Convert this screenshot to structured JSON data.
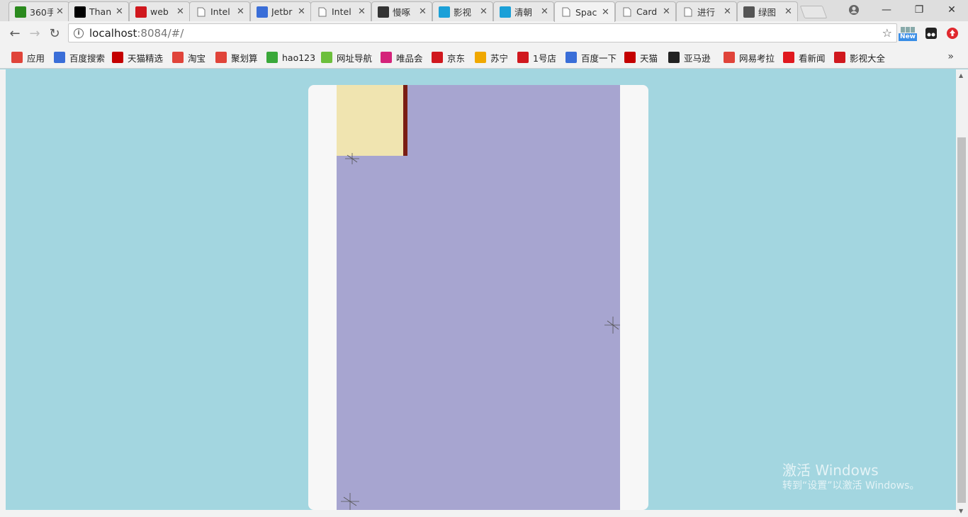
{
  "tabs": [
    {
      "label": "360手",
      "icon": "360-browser-icon",
      "color": "#2b8a1e"
    },
    {
      "label": "Than",
      "icon": "jetbrains-jb-icon",
      "color": "#000000"
    },
    {
      "label": "web",
      "icon": "c-logo-icon",
      "color": "#d0181e"
    },
    {
      "label": "Intel",
      "icon": "document-icon",
      "color": "#888888"
    },
    {
      "label": "Jetbr",
      "icon": "baidu-paw-icon",
      "color": "#3a6ed8"
    },
    {
      "label": "Intel",
      "icon": "document-icon",
      "color": "#888888"
    },
    {
      "label": "慢啄",
      "icon": "mz-logo-icon",
      "color": "#333333"
    },
    {
      "label": "影视",
      "icon": "bilibili-tv-icon",
      "color": "#1ba0d8"
    },
    {
      "label": "清朝",
      "icon": "bilibili-tv-icon",
      "color": "#1ba0d8"
    },
    {
      "label": "Spac",
      "icon": "document-icon",
      "color": "#888888",
      "active": true
    },
    {
      "label": "Card",
      "icon": "document-icon",
      "color": "#888888"
    },
    {
      "label": "进行",
      "icon": "document-icon",
      "color": "#888888"
    },
    {
      "label": "绿图",
      "icon": "link-hook-icon",
      "color": "#555555"
    }
  ],
  "address": {
    "host": "localhost",
    "rest": ":8084/#/"
  },
  "extensions": {
    "new_badge": "New"
  },
  "bookmarks": [
    {
      "label": "应用",
      "icon": "apps-grid-icon",
      "color": "#e0443a"
    },
    {
      "label": "百度搜索",
      "icon": "baidu-paw-icon",
      "color": "#3a6ed8"
    },
    {
      "label": "天猫精选",
      "icon": "tmall-t-icon",
      "color": "#c40000"
    },
    {
      "label": "淘宝",
      "icon": "taobao-icon",
      "color": "#e0443a"
    },
    {
      "label": "聚划算",
      "icon": "juhuasuan-icon",
      "color": "#e0443a"
    },
    {
      "label": "hao123",
      "icon": "hao123-icon",
      "color": "#3aa83a"
    },
    {
      "label": "网址导航",
      "icon": "7654-icon",
      "color": "#6cbf3c"
    },
    {
      "label": "唯品会",
      "icon": "vip-icon",
      "color": "#d4237a"
    },
    {
      "label": "京东",
      "icon": "jd-icon",
      "color": "#d0181e"
    },
    {
      "label": "苏宁",
      "icon": "suning-icon",
      "color": "#f0a800"
    },
    {
      "label": "1号店",
      "icon": "yhd-icon",
      "color": "#d0181e"
    },
    {
      "label": "百度一下",
      "icon": "baidu-paw-icon",
      "color": "#3a6ed8"
    },
    {
      "label": "天猫",
      "icon": "tmall-t-icon",
      "color": "#c40000"
    },
    {
      "label": "亚马逊",
      "icon": "amazon-icon",
      "color": "#222222"
    },
    {
      "label": "网易考拉",
      "icon": "kaola-icon",
      "color": "#e0443a"
    },
    {
      "label": "看新闻",
      "icon": "toutiao-icon",
      "color": "#e0181e"
    },
    {
      "label": "影视大全",
      "icon": "play-icon",
      "color": "#d0181e"
    }
  ],
  "watermark": {
    "line1": "激活 Windows",
    "line2": "转到“设置”以激活 Windows。"
  },
  "colors": {
    "page_bg": "#a3d6e0",
    "space_bg": "#a7a5d0",
    "planet": "#f0e4b0",
    "bar": "#7a1e14"
  }
}
